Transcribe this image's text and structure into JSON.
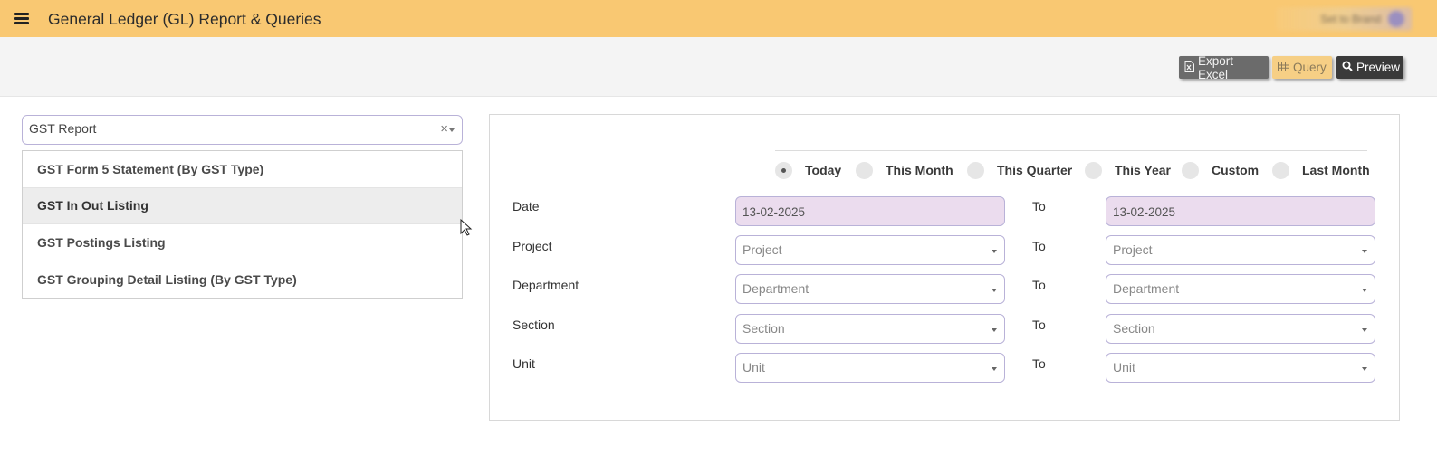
{
  "header": {
    "title": "General Ledger (GL) Report & Queries",
    "user_label": "Set to Brand"
  },
  "toolbar": {
    "export_label": "Export Excel",
    "query_label": "Query",
    "preview_label": "Preview"
  },
  "report_select": {
    "value": "GST Report",
    "clear": "×",
    "options": [
      "GST Form 5 Statement (By GST Type)",
      "GST In Out Listing",
      "GST Postings Listing",
      "GST Grouping Detail Listing (By GST Type)"
    ],
    "hovered_index": 1
  },
  "period": {
    "options": [
      "Today",
      "This Month",
      "This Quarter",
      "This Year",
      "Custom",
      "Last Month"
    ],
    "selected": "Today"
  },
  "filters": {
    "to_label": "To",
    "rows": [
      {
        "label": "Date",
        "from": "13-02-2025",
        "to": "13-02-2025"
      },
      {
        "label": "Project",
        "from": "Project",
        "to": "Project"
      },
      {
        "label": "Department",
        "from": "Department",
        "to": "Department"
      },
      {
        "label": "Section",
        "from": "Section",
        "to": "Section"
      },
      {
        "label": "Unit",
        "from": "Unit",
        "to": "Unit"
      }
    ]
  },
  "colors": {
    "header_bg": "#f9c872",
    "date_field_bg": "#ebdcee",
    "field_border": "#b9b2d8"
  }
}
